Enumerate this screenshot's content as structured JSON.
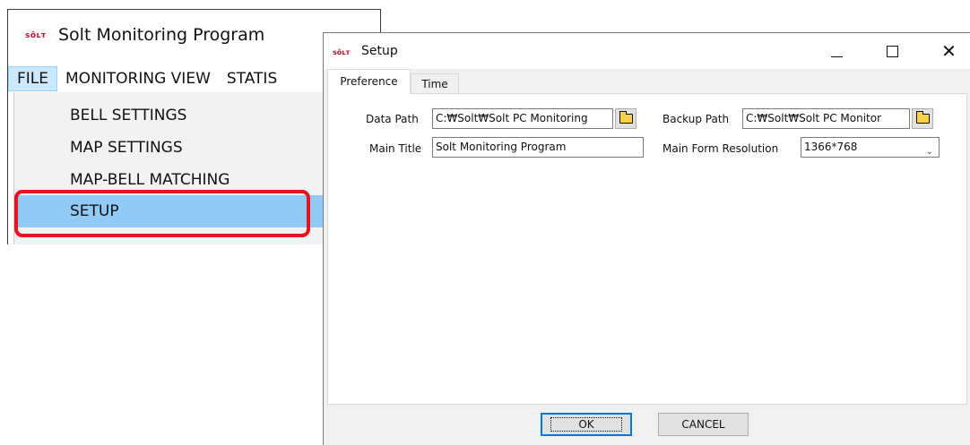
{
  "main_window": {
    "logo_text": "sôʟт",
    "title": "Solt Monitoring Program",
    "menu": [
      "FILE",
      "MONITORING VIEW",
      "STATIS"
    ],
    "file_menu_items": [
      "BELL SETTINGS",
      "MAP SETTINGS",
      "MAP-BELL MATCHING",
      "SETUP"
    ],
    "selected_item": "SETUP",
    "highlight_color": "#e4151f"
  },
  "dialog": {
    "logo_text": "sôʟт",
    "title": "Setup",
    "window_buttons": [
      "minimize-icon",
      "maximize-icon",
      "close-icon"
    ],
    "close_glyph": "✕",
    "tabs": [
      "Preference",
      "Time"
    ],
    "active_tab": "Preference",
    "fields": {
      "data_path_label": "Data Path",
      "data_path_value": "C:₩Solt₩Solt PC Monitoring",
      "backup_path_label": "Backup Path",
      "backup_path_value": "C:₩Solt₩Solt PC Monitor",
      "main_title_label": "Main Title",
      "main_title_value": "Solt Monitoring Program",
      "resolution_label": "Main Form Resolution",
      "resolution_value": "1366*768"
    },
    "buttons": {
      "ok": "OK",
      "cancel": "CANCEL"
    }
  }
}
